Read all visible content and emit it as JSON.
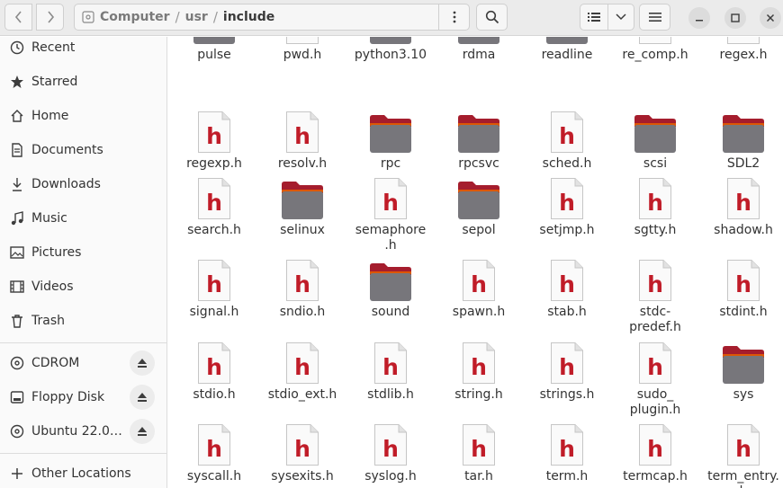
{
  "header": {
    "path": [
      "Computer",
      "usr",
      "include"
    ]
  },
  "sidebar": {
    "places": [
      {
        "label": "Recent",
        "icon": "clock-icon"
      },
      {
        "label": "Starred",
        "icon": "star-icon"
      },
      {
        "label": "Home",
        "icon": "home-icon"
      },
      {
        "label": "Documents",
        "icon": "document-icon"
      },
      {
        "label": "Downloads",
        "icon": "download-icon"
      },
      {
        "label": "Music",
        "icon": "music-icon"
      },
      {
        "label": "Pictures",
        "icon": "picture-icon"
      },
      {
        "label": "Videos",
        "icon": "video-icon"
      },
      {
        "label": "Trash",
        "icon": "trash-icon"
      }
    ],
    "devices": [
      {
        "label": "CDROM",
        "icon": "disc-icon"
      },
      {
        "label": "Floppy Disk",
        "icon": "drive-icon"
      },
      {
        "label": "Ubuntu 22.0…",
        "icon": "disc-icon"
      }
    ],
    "other": {
      "label": "Other Locations",
      "icon": "plus-icon"
    }
  },
  "files": [
    [
      {
        "name": "pulse",
        "type": "folder"
      },
      {
        "name": "pwd.h",
        "type": "header"
      },
      {
        "name": "python3.10",
        "type": "folder"
      },
      {
        "name": "rdma",
        "type": "folder"
      },
      {
        "name": "readline",
        "type": "folder"
      },
      {
        "name": "re_comp.h",
        "type": "header"
      },
      {
        "name": "regex.h",
        "type": "header"
      }
    ],
    [
      {
        "name": "regexp.h",
        "type": "header"
      },
      {
        "name": "resolv.h",
        "type": "header"
      },
      {
        "name": "rpc",
        "type": "folder"
      },
      {
        "name": "rpcsvc",
        "type": "folder"
      },
      {
        "name": "sched.h",
        "type": "header"
      },
      {
        "name": "scsi",
        "type": "folder"
      },
      {
        "name": "SDL2",
        "type": "folder"
      }
    ],
    [
      {
        "name": "search.h",
        "type": "header"
      },
      {
        "name": "selinux",
        "type": "folder"
      },
      {
        "name": "semaphore\n.h",
        "type": "header"
      },
      {
        "name": "sepol",
        "type": "folder"
      },
      {
        "name": "setjmp.h",
        "type": "header"
      },
      {
        "name": "sgtty.h",
        "type": "header"
      },
      {
        "name": "shadow.h",
        "type": "header"
      }
    ],
    [
      {
        "name": "signal.h",
        "type": "header"
      },
      {
        "name": "sndio.h",
        "type": "header"
      },
      {
        "name": "sound",
        "type": "folder"
      },
      {
        "name": "spawn.h",
        "type": "header"
      },
      {
        "name": "stab.h",
        "type": "header"
      },
      {
        "name": "stdc-\npredef.h",
        "type": "header"
      },
      {
        "name": "stdint.h",
        "type": "header"
      }
    ],
    [
      {
        "name": "stdio.h",
        "type": "header"
      },
      {
        "name": "stdio_ext.h",
        "type": "header"
      },
      {
        "name": "stdlib.h",
        "type": "header"
      },
      {
        "name": "string.h",
        "type": "header"
      },
      {
        "name": "strings.h",
        "type": "header"
      },
      {
        "name": "sudo_\nplugin.h",
        "type": "header"
      },
      {
        "name": "sys",
        "type": "folder"
      }
    ],
    [
      {
        "name": "syscall.h",
        "type": "header"
      },
      {
        "name": "sysexits.h",
        "type": "header"
      },
      {
        "name": "syslog.h",
        "type": "header"
      },
      {
        "name": "tar.h",
        "type": "header"
      },
      {
        "name": "term.h",
        "type": "header"
      },
      {
        "name": "termcap.h",
        "type": "header"
      },
      {
        "name": "term_entry.\nh",
        "type": "header"
      }
    ]
  ],
  "colors": {
    "header_letter": "#c01c28",
    "folder_body": "#77767b",
    "folder_tab": "#a51d2d"
  }
}
